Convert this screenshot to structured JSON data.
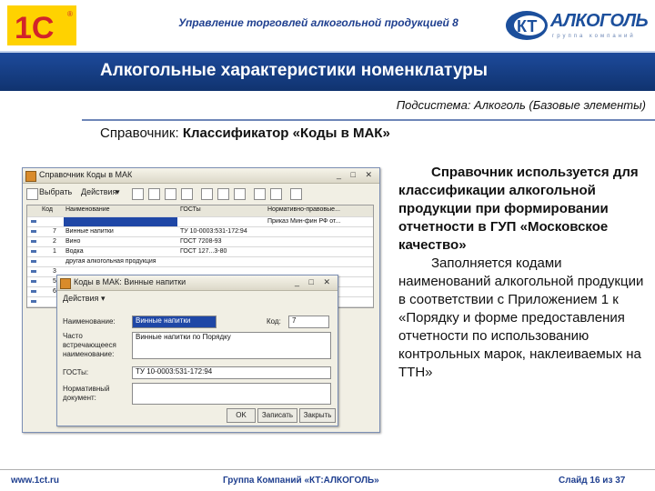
{
  "header": {
    "logo_1c": "1C",
    "title": "Управление торговлей алкогольной продукцией 8",
    "brand_kt": "КТ",
    "brand_name": "АЛКОГОЛЬ",
    "brand_sub": "группа компаний"
  },
  "slide": {
    "title": "Алкогольные характеристики номенклатуры",
    "subsystem": "Подсистема: Алкоголь (Базовые элементы)",
    "directory_label": "Справочник:",
    "directory_value": "Классификатор «Коды в МАК»"
  },
  "main_window": {
    "title": "Справочник Коды в МАК",
    "toolbar": {
      "select": "Выбрать",
      "actions": "Действия"
    },
    "columns": [
      "Код",
      "Наименование",
      "ГОСТы",
      "Нормативно-правовые..."
    ],
    "rows": [
      {
        "code": "",
        "name": "",
        "gost": "",
        "norm": "Приказ Мин-фин РФ от..."
      },
      {
        "code": "7",
        "name": "Винные напитки",
        "gost": "ТУ 10-0003:531-172:94",
        "norm": ""
      },
      {
        "code": "2",
        "name": "Вино",
        "gost": "ГОСТ 7208-93",
        "norm": ""
      },
      {
        "code": "1",
        "name": "Водка",
        "gost": "ГОСТ 127...3-80",
        "norm": ""
      },
      {
        "code": "",
        "name": "другая алкогольная продукция",
        "gost": "",
        "norm": ""
      },
      {
        "code": "3",
        "name": "",
        "gost": "",
        "norm": ""
      },
      {
        "code": "5",
        "name": "",
        "gost": "",
        "norm": ""
      },
      {
        "code": "6",
        "name": "",
        "gost": "",
        "norm": ""
      },
      {
        "code": "",
        "name": "",
        "gost": "",
        "norm": ""
      }
    ]
  },
  "dialog": {
    "title": "Коды в МАК: Винные напитки",
    "toolbar_actions": "Действия",
    "name_label": "Наименование:",
    "name_value": "Винные напитки",
    "code_label": "Код:",
    "code_value": "7",
    "alt_label": "Часто встречающееся наименование:",
    "alt_value": "Винные напитки по Порядку",
    "gost_label": "ГОСТы:",
    "gost_value": "ТУ 10-0003:531-172:94",
    "norm_label": "Нормативный документ:",
    "btn_ok": "OK",
    "btn_save": "Записать",
    "btn_close": "Закрыть"
  },
  "description": {
    "para1": "Справочник используется для классификации алкогольной продукции при формировании отчетности в ГУП «Московское качество»",
    "para2": "Заполняется кодами наименований алкогольной продукции в соответствии с Приложением 1 к «Порядку и форме предоставления отчетности по использованию контрольных марок, наклеиваемых на ТТН»"
  },
  "footer": {
    "site": "www.1ct.ru",
    "company": "Группа Компаний «КТ:АЛКОГОЛЬ»",
    "slide_no": "Слайд 16 из 37"
  },
  "colors": {
    "title_bar": "#1d4a9b",
    "brand_red": "#d2232a",
    "brand_yellow": "#ffd200",
    "selection": "#1f47a6"
  }
}
